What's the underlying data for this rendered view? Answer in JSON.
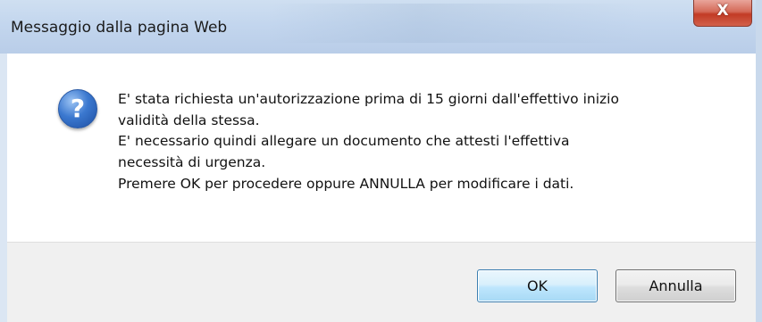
{
  "window": {
    "title": "Messaggio dalla pagina Web",
    "close_label": "X"
  },
  "dialog": {
    "icon": "question-icon",
    "icon_glyph": "?",
    "message_lines": [
      "E' stata richiesta un'autorizzazione prima di 15 giorni dall'effettivo inizio",
      "validità della stessa.",
      "E' necessario quindi allegare un documento che attesti l'effettiva",
      "necessità di urgenza.",
      "Premere OK per procedere oppure ANNULLA per modificare i dati."
    ]
  },
  "buttons": {
    "ok_label": "OK",
    "cancel_label": "Annulla"
  },
  "colors": {
    "titlebar": "#c3d6ee",
    "close_button": "#c23b25",
    "ok_border": "#3c7fb1",
    "footer": "#f0f0f0"
  }
}
